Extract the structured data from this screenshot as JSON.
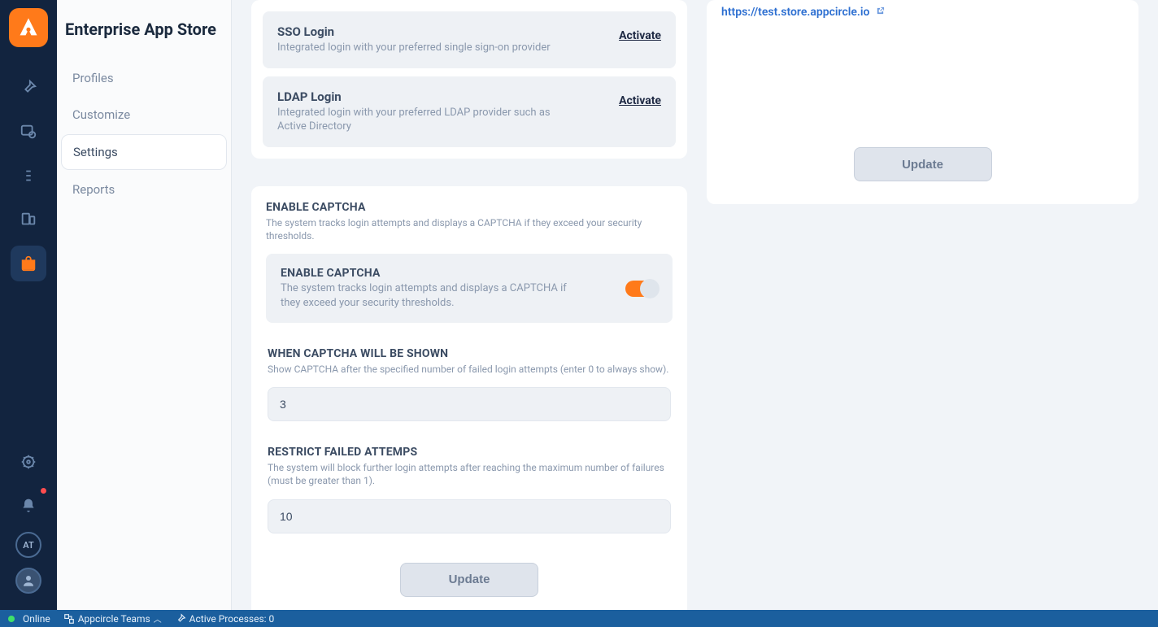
{
  "app": {
    "title": "Enterprise App Store",
    "avatar_initials": "AT"
  },
  "subnav": {
    "items": [
      {
        "label": "Profiles"
      },
      {
        "label": "Customize"
      },
      {
        "label": "Settings"
      },
      {
        "label": "Reports"
      }
    ]
  },
  "login_methods": {
    "sso": {
      "title": "SSO Login",
      "desc": "Integrated login with your preferred single sign-on provider",
      "action": "Activate"
    },
    "ldap": {
      "title": "LDAP Login",
      "desc": "Integrated login with your preferred LDAP provider such as Active Directory",
      "action": "Activate"
    }
  },
  "captcha": {
    "header_title": "ENABLE CAPTCHA",
    "header_desc": "The system tracks login attempts and displays a CAPTCHA if they exceed your security thresholds.",
    "toggle_title": "ENABLE CAPTCHA",
    "toggle_desc": "The system tracks login attempts and displays a CAPTCHA if they exceed your security thresholds.",
    "toggle_on": true,
    "when_title": "WHEN CAPTCHA WILL BE SHOWN",
    "when_desc": "Show CAPTCHA after the specified number of failed login attempts (enter 0 to always show).",
    "when_value": "3",
    "restrict_title": "RESTRICT FAILED ATTEMPS",
    "restrict_desc": "The system will block further login attempts after reaching the maximum number of failures (must be greater than 1).",
    "restrict_value": "10",
    "update_label": "Update"
  },
  "right_panel": {
    "link_text": "https://test.store.appcircle.io",
    "update_label": "Update"
  },
  "statusbar": {
    "online": "Online",
    "teams": "Appcircle Teams",
    "processes": "Active Processes: 0"
  }
}
